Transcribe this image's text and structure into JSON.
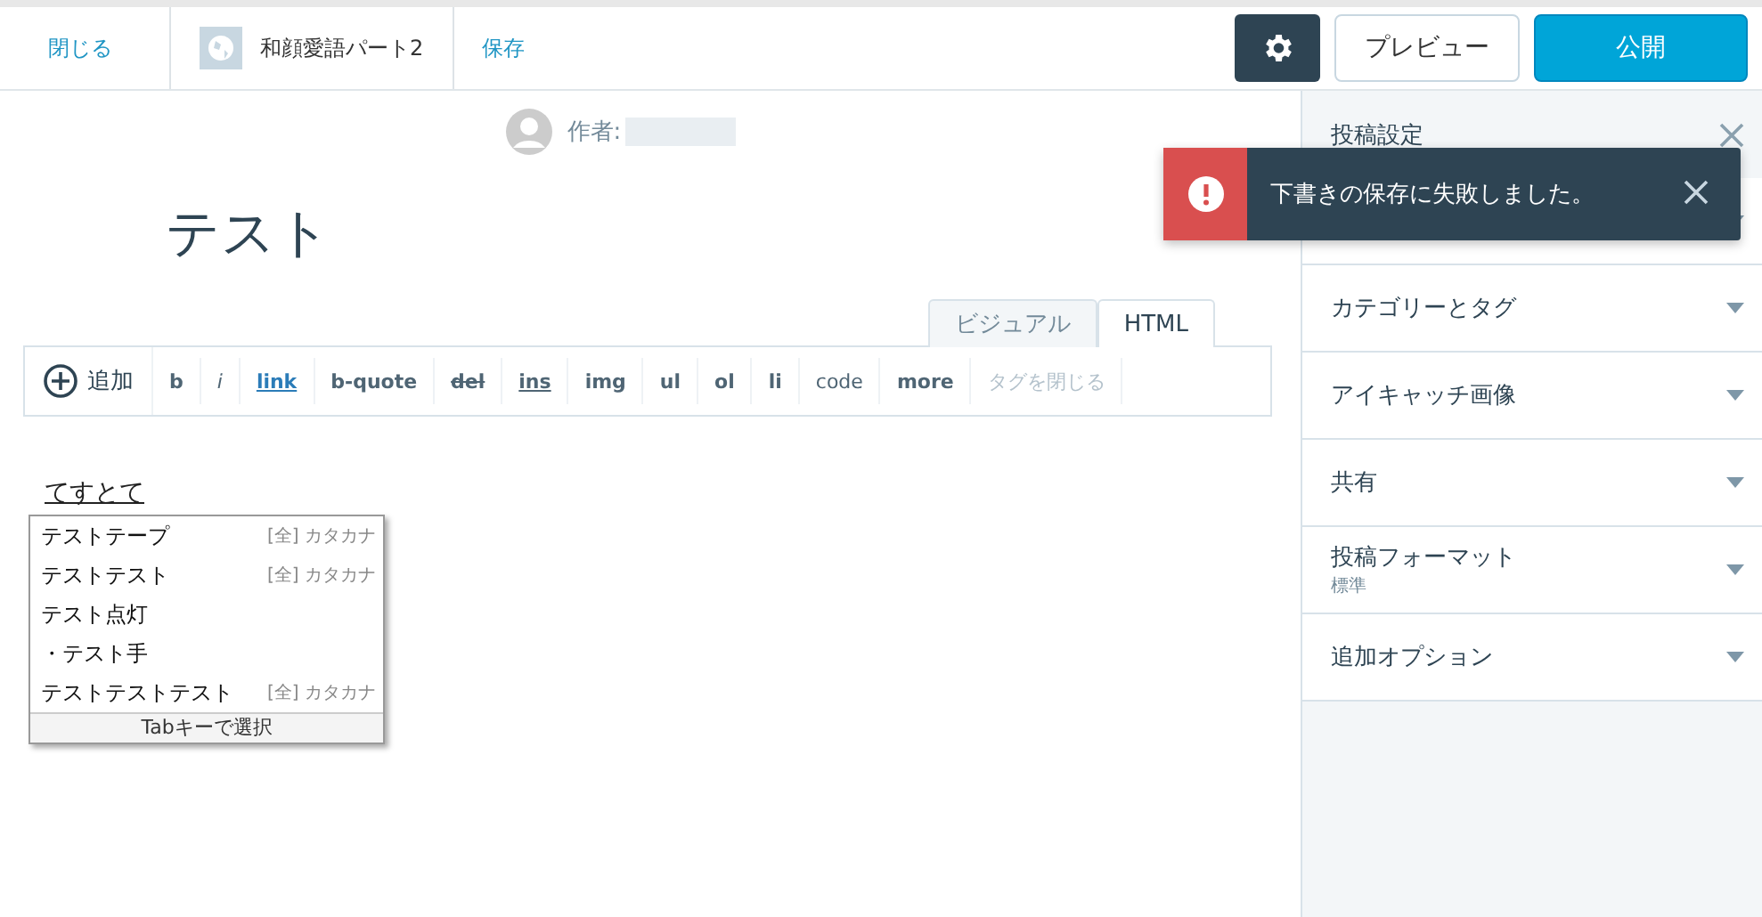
{
  "topbar": {
    "close": "閉じる",
    "site": "和顔愛語パート2",
    "save": "保存",
    "preview": "プレビュー",
    "publish": "公開"
  },
  "author": {
    "label": "作者:"
  },
  "post": {
    "title": "テスト",
    "body": "てすとて"
  },
  "editor_tabs": [
    {
      "label": "ビジュアル",
      "selected": false
    },
    {
      "label": "HTML",
      "selected": true
    }
  ],
  "toolbar": {
    "add": "追加",
    "buttons": [
      {
        "label": "b",
        "kind": "bold",
        "disabled": false
      },
      {
        "label": "i",
        "kind": "italic",
        "disabled": false
      },
      {
        "label": "link",
        "kind": "link",
        "disabled": false
      },
      {
        "label": "b-quote",
        "kind": "plain",
        "disabled": false
      },
      {
        "label": "del",
        "kind": "strike",
        "disabled": false
      },
      {
        "label": "ins",
        "kind": "underline",
        "disabled": false
      },
      {
        "label": "img",
        "kind": "plain",
        "disabled": false
      },
      {
        "label": "ul",
        "kind": "plain",
        "disabled": false
      },
      {
        "label": "ol",
        "kind": "plain",
        "disabled": false
      },
      {
        "label": "li",
        "kind": "plain",
        "disabled": false
      },
      {
        "label": "code",
        "kind": "mono",
        "disabled": false
      },
      {
        "label": "more",
        "kind": "plain",
        "disabled": false
      },
      {
        "label": "タグを閉じる",
        "kind": "plain",
        "disabled": true
      }
    ]
  },
  "ime_candidates": {
    "items": [
      {
        "text": "テストテープ",
        "hint": "[全] カタカナ"
      },
      {
        "text": "テストテスト",
        "hint": "[全] カタカナ"
      },
      {
        "text": "テスト点灯"
      },
      {
        "text": "・テスト手"
      },
      {
        "text": "テストテストテスト",
        "hint": "[全] カタカナ"
      }
    ],
    "footer": "Tabキーで選択"
  },
  "sidebar": {
    "title": "投稿設定",
    "sections": [
      {
        "label": "カテゴリーとタグ"
      },
      {
        "label": "アイキャッチ画像"
      },
      {
        "label": "共有"
      },
      {
        "label": "投稿フォーマット",
        "sub": "標準"
      },
      {
        "label": "追加オプション"
      }
    ]
  },
  "toast": {
    "message": "下書きの保存に失敗しました。"
  }
}
